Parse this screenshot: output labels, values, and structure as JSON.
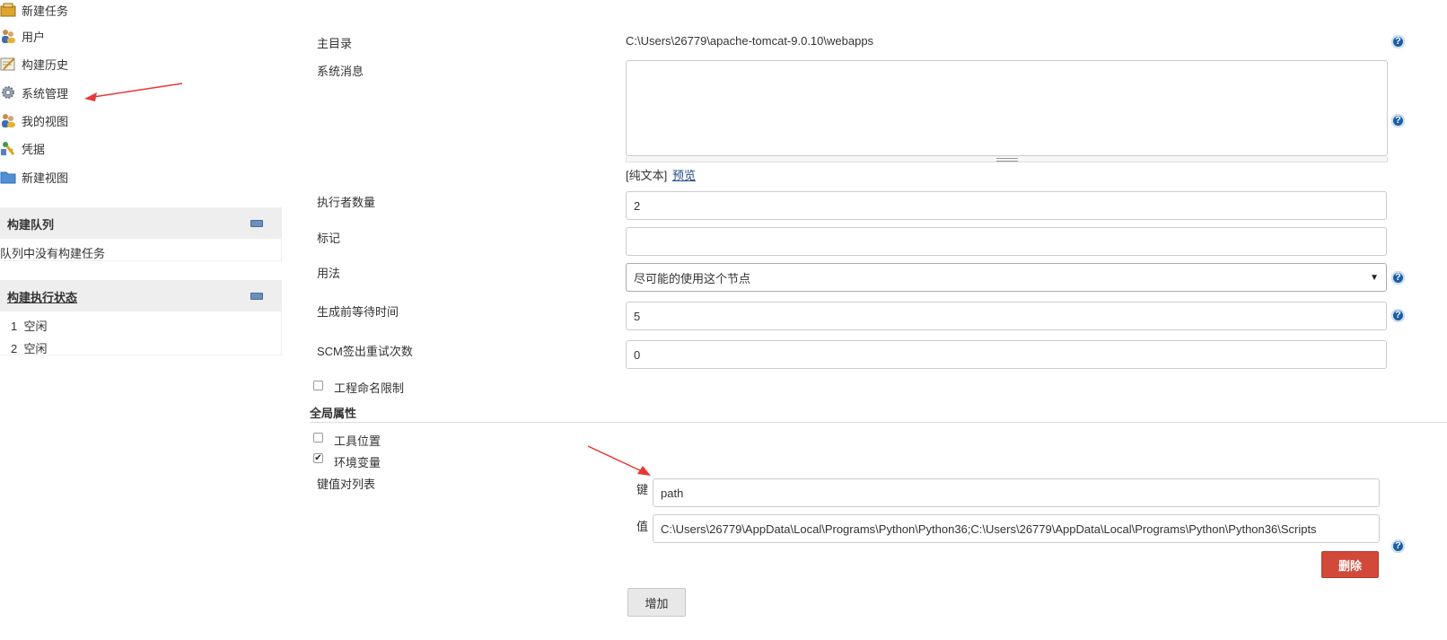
{
  "sidebar": {
    "items": [
      {
        "label": "新建任务",
        "icon": "new-task-icon"
      },
      {
        "label": "用户",
        "icon": "users-icon"
      },
      {
        "label": "构建历史",
        "icon": "build-history-icon"
      },
      {
        "label": "系统管理",
        "icon": "gear-icon"
      },
      {
        "label": "我的视图",
        "icon": "my-view-icon"
      },
      {
        "label": "凭据",
        "icon": "credentials-icon"
      },
      {
        "label": "新建视图",
        "icon": "folder-icon"
      }
    ],
    "build_queue": {
      "title": "构建队列",
      "empty_text": "队列中没有构建任务"
    },
    "executor_status": {
      "title": "构建执行状态",
      "executors": [
        {
          "num": "1",
          "state": "空闲"
        },
        {
          "num": "2",
          "state": "空闲"
        }
      ]
    }
  },
  "form": {
    "home_dir": {
      "label": "主目录",
      "value": "C:\\Users\\26779\\apache-tomcat-9.0.10\\webapps"
    },
    "system_message": {
      "label": "系统消息",
      "value": ""
    },
    "format": {
      "plain_text": "[纯文本]",
      "preview": "预览"
    },
    "executors": {
      "label": "执行者数量",
      "value": "2"
    },
    "labels": {
      "label": "标记",
      "value": ""
    },
    "usage": {
      "label": "用法",
      "value": "尽可能的使用这个节点"
    },
    "quiet_period": {
      "label": "生成前等待时间",
      "value": "5"
    },
    "scm_retry": {
      "label": "SCM签出重试次数",
      "value": "0"
    },
    "project_naming": {
      "label": "工程命名限制",
      "checked": false
    },
    "global_properties": {
      "title": "全局属性"
    },
    "tool_locations": {
      "label": "工具位置",
      "checked": false
    },
    "env_vars": {
      "label": "环境变量",
      "checked": true
    },
    "kv_list": {
      "label": "键值对列表",
      "key_label": "键",
      "key_value": "path",
      "value_label": "值",
      "value_value": "C:\\Users\\26779\\AppData\\Local\\Programs\\Python\\Python36;C:\\Users\\26779\\AppData\\Local\\Programs\\Python\\Python36\\Scripts"
    },
    "delete_button": "删除",
    "add_button": "增加",
    "help_glyph": "?"
  },
  "colors": {
    "accent_red": "#d24939",
    "help_blue": "#1b5ea4",
    "panel_gray": "#eeeeee",
    "annotation_arrow": "#e53935"
  }
}
